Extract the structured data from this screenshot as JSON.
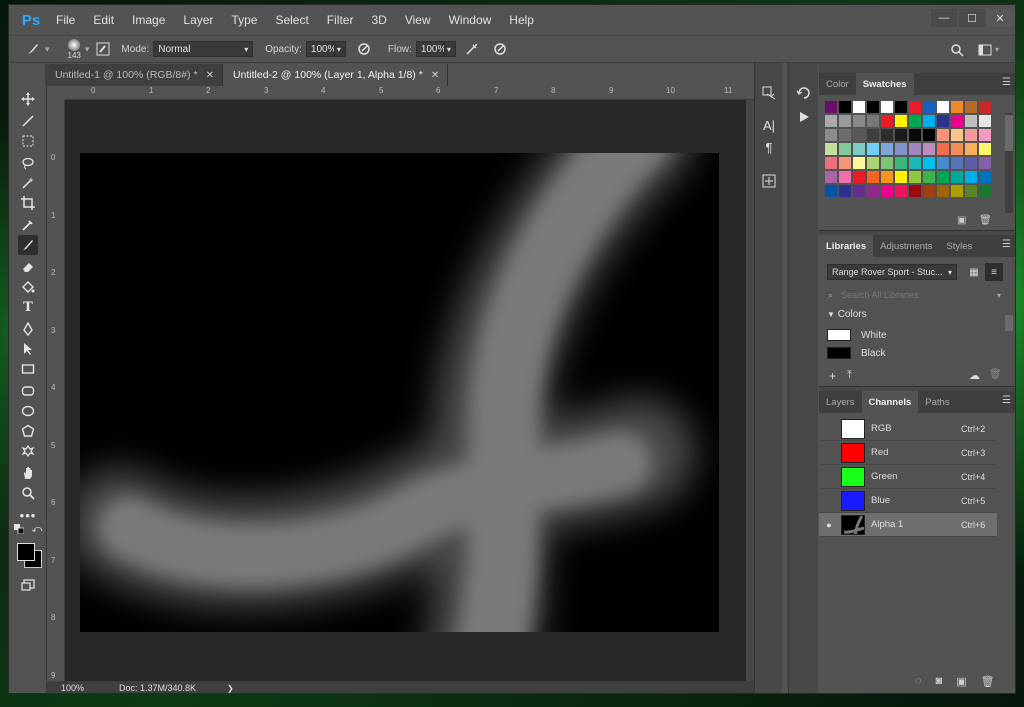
{
  "app": {
    "logo": "Ps"
  },
  "menu": [
    "File",
    "Edit",
    "Image",
    "Layer",
    "Type",
    "Select",
    "Filter",
    "3D",
    "View",
    "Window",
    "Help"
  ],
  "window_controls": {
    "minimize": "—",
    "maximize": "☐",
    "close": "✕"
  },
  "options": {
    "brush_size": "143",
    "mode_label": "Mode:",
    "mode_value": "Normal",
    "opacity_label": "Opacity:",
    "opacity_value": "100%",
    "flow_label": "Flow:",
    "flow_value": "100%"
  },
  "tabs": [
    {
      "label": "Untitled-1 @ 100% (RGB/8#) *",
      "close": "✕",
      "active": false
    },
    {
      "label": "Untitled-2 @ 100% (Layer 1, Alpha 1/8) *",
      "close": "✕",
      "active": true
    }
  ],
  "ruler": {
    "top": [
      "0",
      "1",
      "2",
      "3",
      "4",
      "5",
      "6",
      "7",
      "8",
      "9",
      "10",
      "11"
    ],
    "left": [
      "0",
      "1",
      "2",
      "3",
      "4",
      "5",
      "6",
      "7",
      "8",
      "9"
    ]
  },
  "status": {
    "zoom": "100%",
    "doc": "Doc: 1.37M/340.8K",
    "arrow": "❯"
  },
  "swatches_panel": {
    "tabs": [
      "Color",
      "Swatches"
    ],
    "rows": [
      [
        "#6b0f6b",
        "#000000",
        "#ffffff",
        "#000000",
        "#ffffff",
        "#000000",
        "#e81c2a",
        "#1a5fbf",
        "#ffffff",
        "#f08a28",
        "#b46a28",
        "#c82828"
      ],
      [
        "#aaaaaa",
        "#9a9a9a",
        "#888888",
        "#787878",
        "#ec1c24",
        "#fff200",
        "#00a651",
        "#00aeef",
        "#2e3192",
        "#ec008c",
        "#bfbfbf",
        "#e5e5e5"
      ],
      [
        "#8c8c8c",
        "#6e6e6e",
        "#595959",
        "#404040",
        "#2e2e2e",
        "#1a1a1a",
        "#0a0a0a",
        "#000000",
        "#f79679",
        "#fdc689",
        "#f6989d",
        "#f49ac1"
      ],
      [
        "#c4df9b",
        "#82ca9c",
        "#7accc8",
        "#6dcff6",
        "#7da7d9",
        "#8393ca",
        "#a187be",
        "#bd8cbf",
        "#f26c4f",
        "#f68e56",
        "#fbaf5d",
        "#fff568"
      ],
      [
        "#f26d7d",
        "#f7977a",
        "#fff799",
        "#acd373",
        "#7cc576",
        "#3bb878",
        "#1abbb4",
        "#00bff3",
        "#448ccb",
        "#5574b9",
        "#605ca8",
        "#855fa8"
      ],
      [
        "#a864a8",
        "#f06eaa",
        "#ed1c24",
        "#f26522",
        "#f7941d",
        "#fff200",
        "#8dc73f",
        "#39b54a",
        "#00a651",
        "#00a99d",
        "#00aeef",
        "#0072bc"
      ],
      [
        "#0054a6",
        "#2e3192",
        "#662d91",
        "#92278f",
        "#ec008c",
        "#ed145b",
        "#9e0b0f",
        "#a0410d",
        "#a3620a",
        "#aba000",
        "#598527",
        "#197b30"
      ]
    ]
  },
  "libraries_panel": {
    "tabs": [
      "Libraries",
      "Adjustments",
      "Styles"
    ],
    "library_name": "Range Rover Sport - Stuc...",
    "search_placeholder": "Search All Libraries",
    "colors_heading": "Colors",
    "colors": [
      {
        "name": "White",
        "hex": "#ffffff"
      },
      {
        "name": "Black",
        "hex": "#000000"
      }
    ]
  },
  "channels_panel": {
    "tabs": [
      "Layers",
      "Channels",
      "Paths"
    ],
    "channels": [
      {
        "name": "RGB",
        "shortcut": "Ctrl+2",
        "color": "#ffffff",
        "visible": ""
      },
      {
        "name": "Red",
        "shortcut": "Ctrl+3",
        "color": "#ff0000",
        "visible": ""
      },
      {
        "name": "Green",
        "shortcut": "Ctrl+4",
        "color": "#1aff1a",
        "visible": ""
      },
      {
        "name": "Blue",
        "shortcut": "Ctrl+5",
        "color": "#1a1aff",
        "visible": ""
      },
      {
        "name": "Alpha 1",
        "shortcut": "Ctrl+6",
        "color": "#000000",
        "visible": "●"
      }
    ]
  },
  "colors": {
    "accent": "#31a8ff",
    "panel_bg": "#535353",
    "dark_bg": "#282828"
  }
}
